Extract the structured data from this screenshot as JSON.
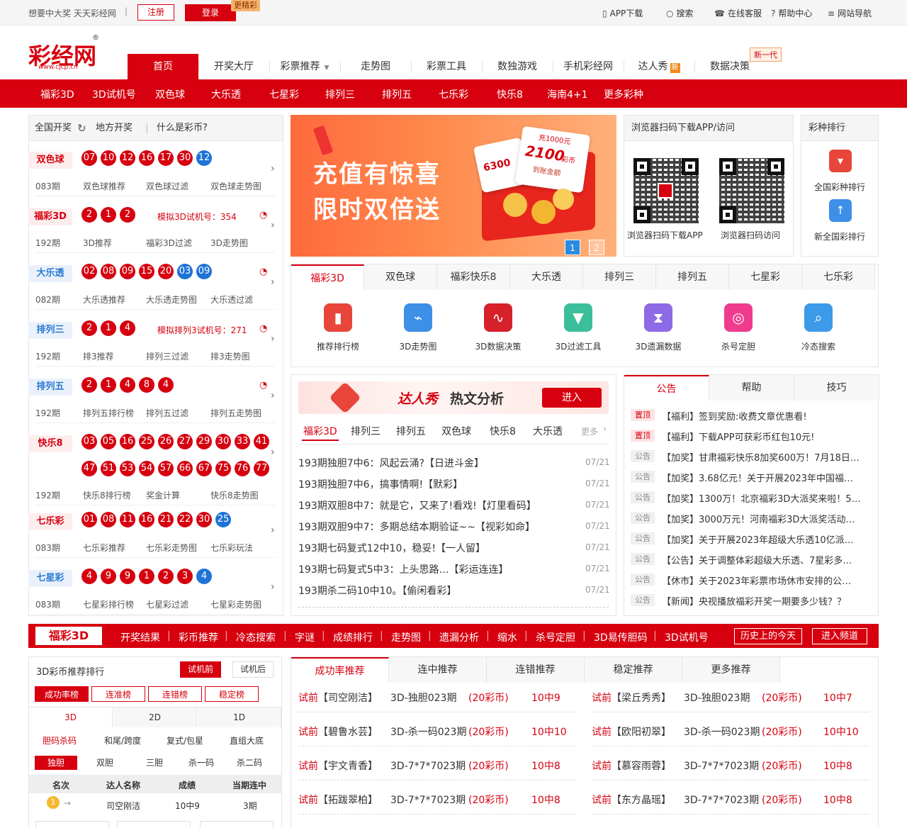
{
  "topbar": {
    "slogan": "想要中大奖 天天彩经网",
    "sep": "|",
    "register": "注册",
    "login": "登录",
    "more_tag": "更精彩",
    "links": [
      {
        "icon": "phone-icon",
        "glyph": "▯",
        "label": "APP下载"
      },
      {
        "icon": "search-icon",
        "glyph": "○",
        "label": "搜索"
      },
      {
        "icon": "service-icon",
        "glyph": "☎",
        "label": "在线客服"
      },
      {
        "icon": "help-icon",
        "glyph": "?",
        "label": "帮助中心"
      },
      {
        "icon": "menu-icon",
        "glyph": "≡",
        "label": "网站导航"
      }
    ]
  },
  "logo": {
    "text": "彩经网",
    "url": "www.cjcp.cn",
    "reg": "®"
  },
  "nav": [
    "首页",
    "开奖大厅",
    "彩票推荐",
    "走势图",
    "彩票工具",
    "数独游戏",
    "手机彩经网",
    "达人秀",
    "数据决策"
  ],
  "nav_badge_new": "新",
  "nav_new_gen": "新一代",
  "lottery_links": [
    "福彩3D",
    "3D试机号",
    "双色球",
    "大乐透",
    "七星彩",
    "排列三",
    "排列五",
    "七乐彩",
    "快乐8",
    "海南4+1",
    "更多彩种"
  ],
  "draw": {
    "tabs": [
      "全国开奖",
      "地方开奖",
      "什么是彩币?"
    ],
    "rows": [
      {
        "name": "双色球",
        "period": "083期",
        "links": [
          "双色球推荐",
          "双色球过滤",
          "双色球走势图"
        ],
        "red": [
          "07",
          "10",
          "12",
          "16",
          "17",
          "30"
        ],
        "blue": [
          "12"
        ]
      },
      {
        "name": "福彩3D",
        "period": "192期",
        "links": [
          "3D推荐",
          "福彩3D过滤",
          "3D走势图"
        ],
        "red": [
          "2",
          "1",
          "2"
        ],
        "blue": [],
        "trial": "模拟3D试机号：354"
      },
      {
        "name": "大乐透",
        "period": "082期",
        "links": [
          "大乐透推荐",
          "大乐透走势图",
          "大乐透过滤"
        ],
        "red": [
          "02",
          "08",
          "09",
          "15",
          "20"
        ],
        "blue": [
          "03",
          "09"
        ]
      },
      {
        "name": "排列三",
        "period": "192期",
        "links": [
          "排3推荐",
          "排列三过滤",
          "排3走势图"
        ],
        "red": [
          "2",
          "1",
          "4"
        ],
        "blue": [],
        "trial": "模拟排列3试机号：271"
      },
      {
        "name": "排列五",
        "period": "192期",
        "links": [
          "排列五排行榜",
          "排列五过滤",
          "排列五走势图"
        ],
        "red": [
          "2",
          "1",
          "4",
          "8",
          "4"
        ],
        "blue": []
      },
      {
        "name": "快乐8",
        "period": "192期",
        "links": [
          "快乐8排行榜",
          "奖金计算",
          "快乐8走势图"
        ],
        "red": [
          "03",
          "05",
          "16",
          "25",
          "26",
          "27",
          "29",
          "30",
          "33",
          "41",
          "47",
          "51",
          "53",
          "54",
          "57",
          "66",
          "67",
          "75",
          "76",
          "77"
        ],
        "blue": []
      },
      {
        "name": "七乐彩",
        "period": "083期",
        "links": [
          "七乐彩推荐",
          "七乐彩走势图",
          "七乐彩玩法"
        ],
        "red": [
          "01",
          "08",
          "11",
          "16",
          "21",
          "22",
          "30"
        ],
        "blue": [
          "25"
        ]
      },
      {
        "name": "七星彩",
        "period": "083期",
        "links": [
          "七星彩排行榜",
          "七星彩过滤",
          "七星彩走势图"
        ],
        "red": [
          "4",
          "9",
          "9",
          "1",
          "2",
          "3"
        ],
        "blue": [
          "4"
        ]
      }
    ]
  },
  "banner": {
    "line1": "充值有惊喜",
    "line2": "限时双倍送",
    "amount1": "2100",
    "unit": "彩币",
    "amount2": "6300",
    "amount3": "充1000元",
    "note": "到账金额",
    "pages": [
      "1",
      "2"
    ]
  },
  "qr": {
    "title": "浏览器扫码下载APP/访问",
    "cap1": "浏览器扫码下载APP",
    "cap2": "浏览器扫码访问"
  },
  "rank": {
    "title": "彩种排行",
    "items": [
      "全国彩种排行",
      "新全国彩排行"
    ]
  },
  "tools": {
    "tabs": [
      "福彩3D",
      "双色球",
      "福彩快乐8",
      "大乐透",
      "排列三",
      "排列五",
      "七星彩",
      "七乐彩"
    ],
    "items": [
      {
        "label": "推荐排行榜",
        "icon": "bar-chart-icon",
        "color": "#e8463a",
        "glyph": "▮"
      },
      {
        "label": "3D走势图",
        "icon": "trend-icon",
        "color": "#3d8fe8",
        "glyph": "⌁"
      },
      {
        "label": "3D数据决策",
        "icon": "pulse-icon",
        "color": "#d6202a",
        "glyph": "∿"
      },
      {
        "label": "3D过滤工具",
        "icon": "filter-icon",
        "color": "#3bbf9a",
        "glyph": "▼"
      },
      {
        "label": "3D遗漏数据",
        "icon": "hourglass-icon",
        "color": "#8d6ae6",
        "glyph": "⧗"
      },
      {
        "label": "杀号定胆",
        "icon": "target-icon",
        "color": "#ef3b8e",
        "glyph": "◎"
      },
      {
        "label": "冷态搜索",
        "icon": "search-icon",
        "color": "#3d9ae8",
        "glyph": "⌕"
      }
    ]
  },
  "articles": {
    "banner_a": "达人秀",
    "banner_b": "热文分析",
    "enter": "进入",
    "tabs": [
      "福彩3D",
      "排列三",
      "排列五",
      "双色球",
      "快乐8",
      "大乐透"
    ],
    "more": "更多",
    "items": [
      {
        "title": "193期独胆7中6：风起云涌?【日进斗金】",
        "date": "07/21"
      },
      {
        "title": "193期独胆7中6，搞事情啊!【默彩】",
        "date": "07/21"
      },
      {
        "title": "193期双胆8中7：就是它，又来了!看戏!【灯里看码】",
        "date": "07/21"
      },
      {
        "title": "193期双胆9中7：多期总结本期验证~~【视彩如命】",
        "date": "07/21"
      },
      {
        "title": "193期七码复式12中10，稳妥!【一人留】",
        "date": "07/21"
      },
      {
        "title": "193期七码复式5中3：上头思路…【彩运连连】",
        "date": "07/21"
      },
      {
        "title": "193期杀二码10中10。【偷闲看彩】",
        "date": "07/21"
      }
    ]
  },
  "notice": {
    "tabs": [
      "公告",
      "帮助",
      "技巧"
    ],
    "items": [
      {
        "tag": "置顶",
        "text": "【福利】签到奖励:收费文章优惠看!"
      },
      {
        "tag": "置顶",
        "text": "【福利】下载APP可获彩币红包10元!"
      },
      {
        "tag": "公告",
        "text": "【加奖】甘肃福彩快乐8加奖600万！7月18日…"
      },
      {
        "tag": "公告",
        "text": "【加奖】3.68亿元！关于开展2023年中国福…"
      },
      {
        "tag": "公告",
        "text": "【加奖】1300万！北京福彩3D大派奖来啦！5…"
      },
      {
        "tag": "公告",
        "text": "【加奖】3000万元！河南福彩3D大派奖活动…"
      },
      {
        "tag": "公告",
        "text": "【加奖】关于开展2023年超级大乐透10亿派…"
      },
      {
        "tag": "公告",
        "text": "【公告】关于调整体彩超级大乐透、7星彩多…"
      },
      {
        "tag": "公告",
        "text": "【休市】关于2023年彩票市场休市安排的公…"
      },
      {
        "tag": "公告",
        "text": "【新闻】央视播放福彩开奖一期要多少钱？？"
      }
    ]
  },
  "bar3d": {
    "label": "福彩3D",
    "links": [
      "开奖结果",
      "彩币推荐",
      "冷态搜索",
      "字谜",
      "成绩排行",
      "走势图",
      "遗漏分析",
      "缩水",
      "杀号定胆",
      "3D易传胆码",
      "3D试机号"
    ],
    "btn1": "历史上的今天",
    "btn2": "进入频道"
  },
  "ranking": {
    "title": "3D彩币推荐排行",
    "mode": [
      "试机前",
      "试机后"
    ],
    "boards": [
      "成功率榜",
      "连准榜",
      "连错榜",
      "稳定榜"
    ],
    "dims": [
      "3D",
      "2D",
      "1D"
    ],
    "cats": [
      "胆码杀码",
      "和尾/跨度",
      "复式/包星",
      "直组大底"
    ],
    "subs": [
      "独胆",
      "双胆",
      "三胆",
      "杀一码",
      "杀二码"
    ],
    "headers": [
      "名次",
      "达人名称",
      "成绩",
      "当期连中"
    ],
    "rows": [
      {
        "name": "司空刚洁",
        "score": "10中9",
        "streak": "3期"
      }
    ]
  },
  "rec": {
    "tabs": [
      "成功率推荐",
      "连中推荐",
      "连错推荐",
      "稳定推荐",
      "更多推荐"
    ],
    "left": [
      {
        "tag": "试前",
        "user": "【司空刚洁】",
        "item": "3D-独胆023期",
        "price": "(20彩币)",
        "res": "10中9"
      },
      {
        "tag": "试前",
        "user": "【碧鲁水芸】",
        "item": "3D-杀一码023期",
        "price": "(20彩币)",
        "res": "10中10"
      },
      {
        "tag": "试前",
        "user": "【宇文青香】",
        "item": "3D-7*7*7023期",
        "price": "(20彩币)",
        "res": "10中8"
      },
      {
        "tag": "试前",
        "user": "【拓跋翠柏】",
        "item": "3D-7*7*7023期",
        "price": "(20彩币)",
        "res": "10中8"
      }
    ],
    "right": [
      {
        "tag": "试前",
        "user": "【梁丘秀秀】",
        "item": "3D-独胆023期",
        "price": "(20彩币)",
        "res": "10中7"
      },
      {
        "tag": "试前",
        "user": "【欧阳初翠】",
        "item": "3D-杀一码023期",
        "price": "(20彩币)",
        "res": "10中10"
      },
      {
        "tag": "试前",
        "user": "【慕容雨蓉】",
        "item": "3D-7*7*7023期",
        "price": "(20彩币)",
        "res": "10中8"
      },
      {
        "tag": "试前",
        "user": "【东方晶瑶】",
        "item": "3D-7*7*7023期",
        "price": "(20彩币)",
        "res": "10中8"
      }
    ]
  },
  "colors": {
    "brand": "#d6000f",
    "blue_ball": "#1e73d6"
  }
}
